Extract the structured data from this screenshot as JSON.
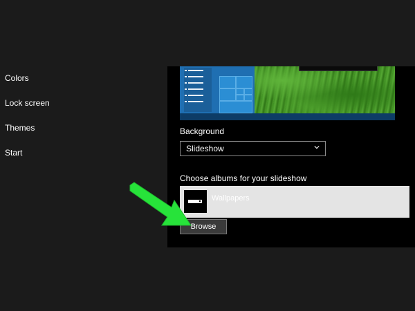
{
  "nav": {
    "items": [
      {
        "label": "Colors"
      },
      {
        "label": "Lock screen"
      },
      {
        "label": "Themes"
      },
      {
        "label": "Start"
      }
    ]
  },
  "background": {
    "label": "Background",
    "selected": "Slideshow"
  },
  "slideshow": {
    "label": "Choose albums for your slideshow",
    "album_name": "Wallpapers",
    "browse_label": "Browse"
  },
  "icons": {
    "dropdown": "chevron-down-icon",
    "album": "album-icon",
    "annotation": "arrow-pointer-icon"
  },
  "colors": {
    "accent": "#2b8ed4",
    "arrow": "#27e33a",
    "panel": "#000000",
    "sidebar": "#1b1b1b"
  }
}
